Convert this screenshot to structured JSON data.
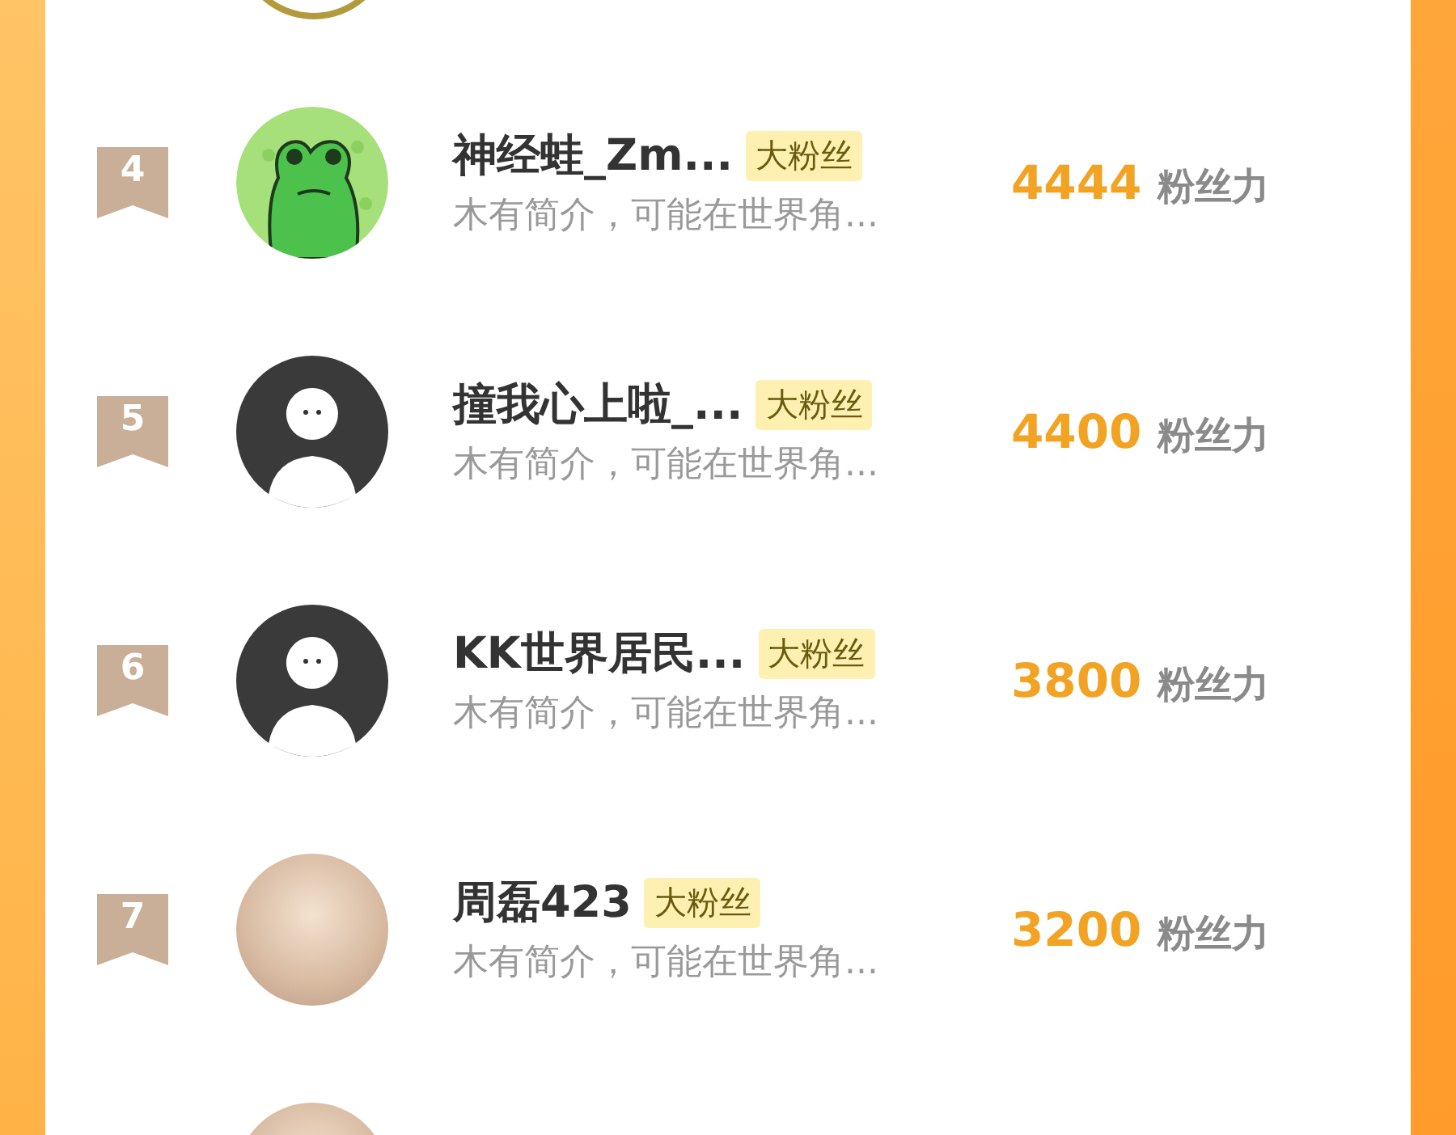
{
  "rows": [
    {
      "rank": "4",
      "kind": "frog",
      "name": "神经蛙_Zm...",
      "badge": "大粉丝",
      "intro": "木有简介，可能在世界角...",
      "score": "4444",
      "score_unit": "粉丝力"
    },
    {
      "rank": "5",
      "kind": "default",
      "name": "撞我心上啦_...",
      "badge": "大粉丝",
      "intro": "木有简介，可能在世界角...",
      "score": "4400",
      "score_unit": "粉丝力"
    },
    {
      "rank": "6",
      "kind": "default",
      "name": "KK世界居民...",
      "badge": "大粉丝",
      "intro": "木有简介，可能在世界角...",
      "score": "3800",
      "score_unit": "粉丝力"
    },
    {
      "rank": "7",
      "kind": "photo",
      "name": "周磊423",
      "badge": "大粉丝",
      "intro": "木有简介，可能在世界角...",
      "score": "3200",
      "score_unit": "粉丝力"
    },
    {
      "kind": "photo"
    }
  ]
}
